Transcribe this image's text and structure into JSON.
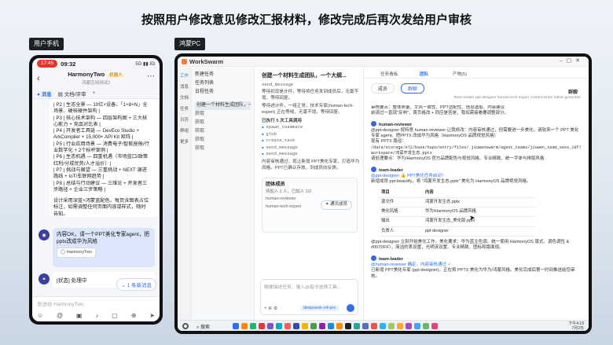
{
  "page_title": "按照用户修改意见修改汇报材料，修改完成后再次发给用户审核",
  "labels": {
    "phone": "用户手机",
    "pc": "鸿蒙PC"
  },
  "phone": {
    "status": {
      "pill": "17:45",
      "time": "09:32",
      "signal": "5G ▮▮ 83"
    },
    "chat": {
      "name": "HarmonyTwo",
      "badge": "机器人",
      "subtitle": "鸿蒙应用测试2"
    },
    "tabs": {
      "message": "消息",
      "docs": "文档/评审"
    },
    "card_lines": [
      "| P2 | 生态全景 — 10亿+设备、「1+8+N」全",
      "场景、硬核硬件架构 |",
      "| P3 | 核心技术架构 — 四层架构图 + 三大核",
      "心能力 + 竞品对比表 |",
      "| P4 | 开发者工具链 — DevEco Studio +",
      "ArkCompiler + 15,000+ API Kit 矩阵 |",
      "| P5 | 行业应用场景 — 消费电子/智能座舱/行",
      "业数字化 + 2个标杆案例 |",
      "| P6 | 生态机遇 — 四重机遇（市场蓝口/政策",
      "红利/分成优势/人才溢价）|",
      "| P7 | 挑战与展望 — 三重挑战 + NEXT 演进",
      "路线 + IoT/车联网趋势 |",
      "| P8 | 总结与行动建议 — 三维论 + 开发者三",
      "步路径 + 企业三步策略 |"
    ],
    "card_footer": [
      "设计采用深蓝+鸿蒙蓝配色，每页含图表占位",
      "标注，如需调整任何页面内容或样式，随时",
      "告知。"
    ],
    "user_msg": "内容OK，请一个PPT美化专家agent，把pptx改成华为风格",
    "user_chip": "HarmonyTwo",
    "status_msg": "[状态] 处理中",
    "new_msg": "1 条新消息",
    "input_placeholder": "发送给 HarmonyTwo"
  },
  "pc": {
    "app_name": "WorkSwarm",
    "iconbar": [
      "工作",
      "消息",
      "文档",
      "任务",
      "日历",
      "群组",
      "更多"
    ],
    "sessions": {
      "top": [
        "新建任务",
        "任务列表",
        "日程任务"
      ],
      "active": "创建一个材料生成团队，一个大...",
      "tail": [
        "获取",
        "获取",
        "获取",
        "获取",
        "获取"
      ]
    },
    "chat": {
      "title": "创建一个材料生成团队，一个大纲...",
      "send_label": "send_message",
      "p1": "等待初设是计件，等待将任务发到成员后，无毫不增，等待回复。",
      "p2": "等待进计件，一组正常，技术专家(human-tech-expert) 正在等候，无毫不增，等待回复。",
      "tools_title": "已执行 5 次工具调用",
      "tools": [
        "spawn_teammate",
        "glob",
        "create_task",
        "send_message",
        "send_message"
      ],
      "p3": "内容审核通过，现让新增 PPT美化专家，打造华为风格。PPT已确认存放，到成员向反馈。",
      "team_title": "团体成员",
      "team_lines": [
        "待加入 1 人，已加入 1/2",
        "human-reviewer",
        "human-tech-expert"
      ],
      "team_btn": "通讯成员",
      "input_ph": "随便描述任务，输入@指令选择工具...",
      "mode": "deepseek-v4-pro"
    },
    "detail": {
      "toolbar": [
        "任务看板",
        "团队",
        "产物(5)"
      ],
      "subtabs": [
        "成员",
        "群聊"
      ],
      "right_label": "群聊",
      "members": "Team-leader ppt-designer human-tech-expert content-writer editor-generator",
      "lines": [
        "审核要点：整体质量、文风一致性、PPT适配性、信息选取、内容建议",
        "前请过一直现\"反响\"，首页格改 + 同应是答是，我如需接看要调整部分。",
        "human-reviewer",
        "@ppt-designer 按特意 human-reviewer 让我修改：内容审核通过，但需要进一步美化，请软来一个 PPT 美化专家 agent。把PPTX 改成华为风格（HarmonyOS 品牌视觉风格）",
        "现有 PPTX 路径：",
        "/data/storage/el2/base/haps/entry/files/.jiuwenswarm/agent_teams/jiuwen_team_sess_19f7fa66fe6_76d8f8e6a47e/team-workspace/鸿蒙开发生态.pptx",
        "请处理要点：华为/HarmonyOS 官方品牌配色与视觉风格、专业精致、统一字体与排版风格",
        "team-leader",
        "@ppt-designer 👍 PPT美化任务启动！",
        "新增成员 ppt-beautify，将 \"鸿蒙开发生态.pptx\" 美化为 HarmonyOS 品牌视觉风格。"
      ],
      "table_head": [
        "项目",
        "内容"
      ],
      "table_rows": [
        [
          "源文件",
          "鸿蒙开发生态.pptx"
        ],
        [
          "美化风格",
          "华为/HarmonyOS 品牌风格"
        ],
        [
          "输出",
          "鸿蒙开发生态_美化版.pptx"
        ],
        [
          "负责人",
          "ppt-designer"
        ]
      ],
      "lines2": [
        "@ppt-designer 立刻开始美化工作。美化要求：华为蓝主色调、统一使用 HarmonyOS 版式、调色调性 & #007DFF），简洁的表设置，光明该设置、专业精致、图标和版面规。",
        "team-leader",
        "@human-reviewer 确定。内容审核通过 ✓",
        "已新增 PPT美化专家 (ppt-designer)，正在将 PPTX 美化为华为/鸿蒙风格。美化完成后第一时间推送给您审核。"
      ]
    },
    "taskbar": {
      "search": "搜索",
      "time": "下午4:19",
      "date": "7月2日"
    }
  }
}
